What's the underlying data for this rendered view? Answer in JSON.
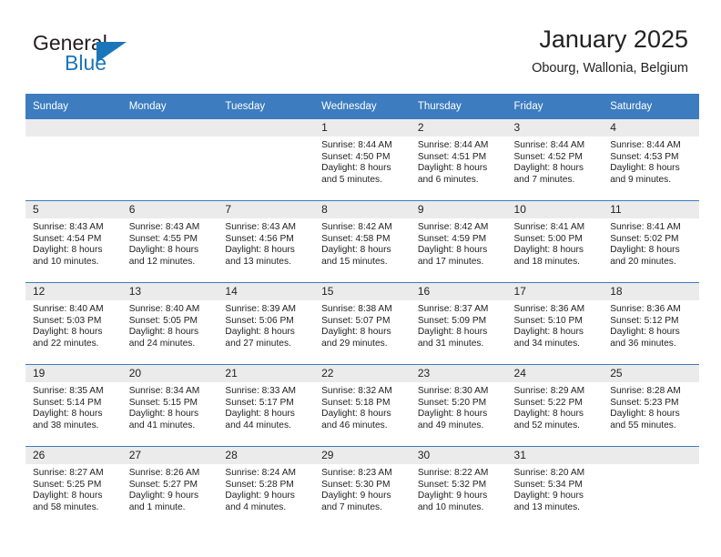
{
  "logo": {
    "word_top": "General",
    "word_bottom": "Blue",
    "accent_color": "#1b75bb"
  },
  "header": {
    "title": "January 2025",
    "subtitle": "Obourg, Wallonia, Belgium"
  },
  "calendar": {
    "header_bg": "#3c7cbf",
    "day_band_bg": "#ebebeb",
    "weekday_headers": [
      "Sunday",
      "Monday",
      "Tuesday",
      "Wednesday",
      "Thursday",
      "Friday",
      "Saturday"
    ],
    "weeks": [
      [
        {
          "day": "",
          "sunrise": "",
          "sunset": "",
          "daylight": ""
        },
        {
          "day": "",
          "sunrise": "",
          "sunset": "",
          "daylight": ""
        },
        {
          "day": "",
          "sunrise": "",
          "sunset": "",
          "daylight": ""
        },
        {
          "day": "1",
          "sunrise": "Sunrise: 8:44 AM",
          "sunset": "Sunset: 4:50 PM",
          "daylight": "Daylight: 8 hours and 5 minutes."
        },
        {
          "day": "2",
          "sunrise": "Sunrise: 8:44 AM",
          "sunset": "Sunset: 4:51 PM",
          "daylight": "Daylight: 8 hours and 6 minutes."
        },
        {
          "day": "3",
          "sunrise": "Sunrise: 8:44 AM",
          "sunset": "Sunset: 4:52 PM",
          "daylight": "Daylight: 8 hours and 7 minutes."
        },
        {
          "day": "4",
          "sunrise": "Sunrise: 8:44 AM",
          "sunset": "Sunset: 4:53 PM",
          "daylight": "Daylight: 8 hours and 9 minutes."
        }
      ],
      [
        {
          "day": "5",
          "sunrise": "Sunrise: 8:43 AM",
          "sunset": "Sunset: 4:54 PM",
          "daylight": "Daylight: 8 hours and 10 minutes."
        },
        {
          "day": "6",
          "sunrise": "Sunrise: 8:43 AM",
          "sunset": "Sunset: 4:55 PM",
          "daylight": "Daylight: 8 hours and 12 minutes."
        },
        {
          "day": "7",
          "sunrise": "Sunrise: 8:43 AM",
          "sunset": "Sunset: 4:56 PM",
          "daylight": "Daylight: 8 hours and 13 minutes."
        },
        {
          "day": "8",
          "sunrise": "Sunrise: 8:42 AM",
          "sunset": "Sunset: 4:58 PM",
          "daylight": "Daylight: 8 hours and 15 minutes."
        },
        {
          "day": "9",
          "sunrise": "Sunrise: 8:42 AM",
          "sunset": "Sunset: 4:59 PM",
          "daylight": "Daylight: 8 hours and 17 minutes."
        },
        {
          "day": "10",
          "sunrise": "Sunrise: 8:41 AM",
          "sunset": "Sunset: 5:00 PM",
          "daylight": "Daylight: 8 hours and 18 minutes."
        },
        {
          "day": "11",
          "sunrise": "Sunrise: 8:41 AM",
          "sunset": "Sunset: 5:02 PM",
          "daylight": "Daylight: 8 hours and 20 minutes."
        }
      ],
      [
        {
          "day": "12",
          "sunrise": "Sunrise: 8:40 AM",
          "sunset": "Sunset: 5:03 PM",
          "daylight": "Daylight: 8 hours and 22 minutes."
        },
        {
          "day": "13",
          "sunrise": "Sunrise: 8:40 AM",
          "sunset": "Sunset: 5:05 PM",
          "daylight": "Daylight: 8 hours and 24 minutes."
        },
        {
          "day": "14",
          "sunrise": "Sunrise: 8:39 AM",
          "sunset": "Sunset: 5:06 PM",
          "daylight": "Daylight: 8 hours and 27 minutes."
        },
        {
          "day": "15",
          "sunrise": "Sunrise: 8:38 AM",
          "sunset": "Sunset: 5:07 PM",
          "daylight": "Daylight: 8 hours and 29 minutes."
        },
        {
          "day": "16",
          "sunrise": "Sunrise: 8:37 AM",
          "sunset": "Sunset: 5:09 PM",
          "daylight": "Daylight: 8 hours and 31 minutes."
        },
        {
          "day": "17",
          "sunrise": "Sunrise: 8:36 AM",
          "sunset": "Sunset: 5:10 PM",
          "daylight": "Daylight: 8 hours and 34 minutes."
        },
        {
          "day": "18",
          "sunrise": "Sunrise: 8:36 AM",
          "sunset": "Sunset: 5:12 PM",
          "daylight": "Daylight: 8 hours and 36 minutes."
        }
      ],
      [
        {
          "day": "19",
          "sunrise": "Sunrise: 8:35 AM",
          "sunset": "Sunset: 5:14 PM",
          "daylight": "Daylight: 8 hours and 38 minutes."
        },
        {
          "day": "20",
          "sunrise": "Sunrise: 8:34 AM",
          "sunset": "Sunset: 5:15 PM",
          "daylight": "Daylight: 8 hours and 41 minutes."
        },
        {
          "day": "21",
          "sunrise": "Sunrise: 8:33 AM",
          "sunset": "Sunset: 5:17 PM",
          "daylight": "Daylight: 8 hours and 44 minutes."
        },
        {
          "day": "22",
          "sunrise": "Sunrise: 8:32 AM",
          "sunset": "Sunset: 5:18 PM",
          "daylight": "Daylight: 8 hours and 46 minutes."
        },
        {
          "day": "23",
          "sunrise": "Sunrise: 8:30 AM",
          "sunset": "Sunset: 5:20 PM",
          "daylight": "Daylight: 8 hours and 49 minutes."
        },
        {
          "day": "24",
          "sunrise": "Sunrise: 8:29 AM",
          "sunset": "Sunset: 5:22 PM",
          "daylight": "Daylight: 8 hours and 52 minutes."
        },
        {
          "day": "25",
          "sunrise": "Sunrise: 8:28 AM",
          "sunset": "Sunset: 5:23 PM",
          "daylight": "Daylight: 8 hours and 55 minutes."
        }
      ],
      [
        {
          "day": "26",
          "sunrise": "Sunrise: 8:27 AM",
          "sunset": "Sunset: 5:25 PM",
          "daylight": "Daylight: 8 hours and 58 minutes."
        },
        {
          "day": "27",
          "sunrise": "Sunrise: 8:26 AM",
          "sunset": "Sunset: 5:27 PM",
          "daylight": "Daylight: 9 hours and 1 minute."
        },
        {
          "day": "28",
          "sunrise": "Sunrise: 8:24 AM",
          "sunset": "Sunset: 5:28 PM",
          "daylight": "Daylight: 9 hours and 4 minutes."
        },
        {
          "day": "29",
          "sunrise": "Sunrise: 8:23 AM",
          "sunset": "Sunset: 5:30 PM",
          "daylight": "Daylight: 9 hours and 7 minutes."
        },
        {
          "day": "30",
          "sunrise": "Sunrise: 8:22 AM",
          "sunset": "Sunset: 5:32 PM",
          "daylight": "Daylight: 9 hours and 10 minutes."
        },
        {
          "day": "31",
          "sunrise": "Sunrise: 8:20 AM",
          "sunset": "Sunset: 5:34 PM",
          "daylight": "Daylight: 9 hours and 13 minutes."
        },
        {
          "day": "",
          "sunrise": "",
          "sunset": "",
          "daylight": ""
        }
      ]
    ]
  }
}
